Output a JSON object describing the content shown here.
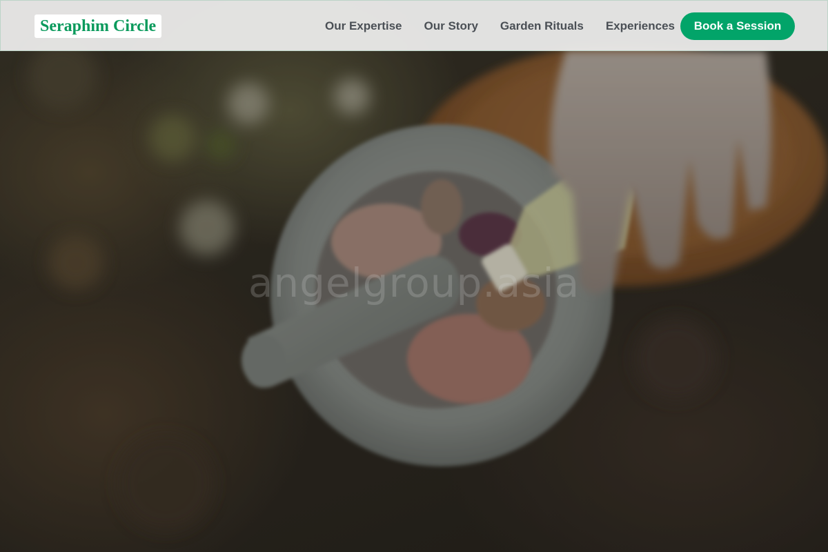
{
  "brand": {
    "name": "Seraphim Circle"
  },
  "nav": {
    "links": [
      {
        "label": "Our Expertise"
      },
      {
        "label": "Our Story"
      },
      {
        "label": "Garden Rituals"
      },
      {
        "label": "Experiences"
      }
    ],
    "cta_label": "Book a Session"
  },
  "hero": {
    "watermark": "angelgroup.asia"
  },
  "colors": {
    "brand_green": "#0a9a5c",
    "cta_green": "#02a469",
    "nav_text": "#4a4f55",
    "nav_bg": "#e9e9e8"
  }
}
